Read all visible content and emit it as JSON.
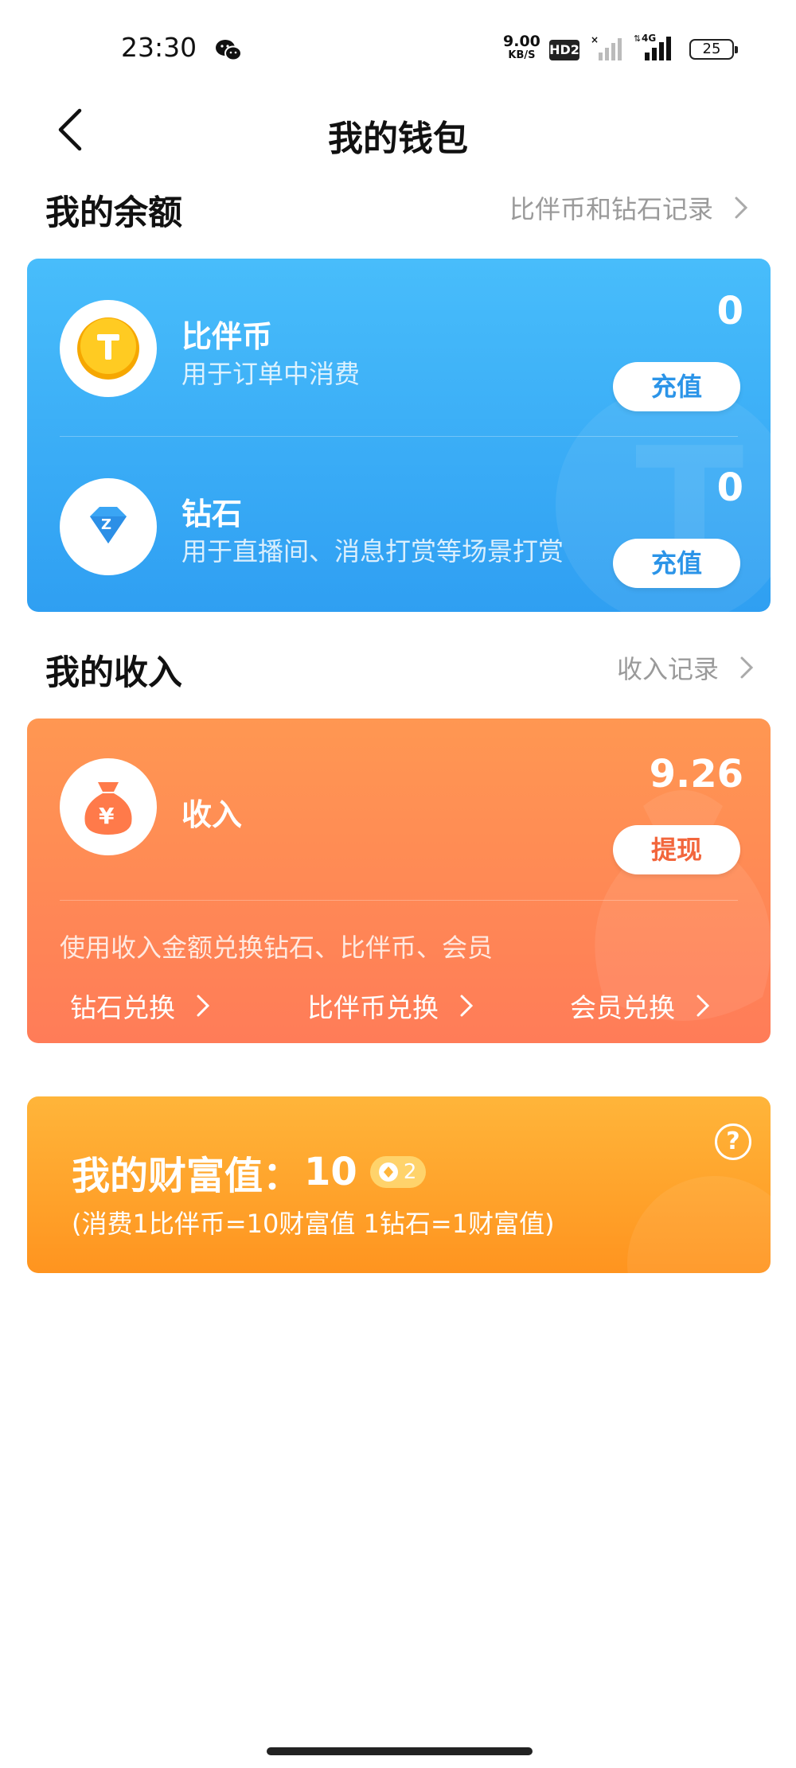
{
  "status_bar": {
    "time": "23:30",
    "net_speed": "9.00",
    "net_unit": "KB/S",
    "hd": "HD2",
    "net_type": "4G",
    "battery": "25"
  },
  "header": {
    "title": "我的钱包"
  },
  "balance": {
    "title": "我的余额",
    "link": "比伴币和钻石记录",
    "items": [
      {
        "name": "比伴币",
        "desc": "用于订单中消费",
        "value": "0",
        "action": "充值"
      },
      {
        "name": "钻石",
        "desc": "用于直播间、消息打赏等场景打赏",
        "value": "0",
        "action": "充值"
      }
    ]
  },
  "income": {
    "title": "我的收入",
    "link": "收入记录",
    "name": "收入",
    "value": "9.26",
    "action": "提现",
    "exchange_hint": "使用收入金额兑换钻石、比伴币、会员",
    "exchanges": [
      "钻石兑换",
      "比伴币兑换",
      "会员兑换"
    ]
  },
  "wealth": {
    "label": "我的财富值：",
    "value": "10",
    "level": "2",
    "rule": "(消费1比伴币=10财富值 1钻石=1财富值)",
    "help": "?"
  },
  "colors": {
    "blue_accent": "#2f9ff2",
    "orange_accent": "#ff7c58",
    "yellow_accent": "#ff941f"
  }
}
